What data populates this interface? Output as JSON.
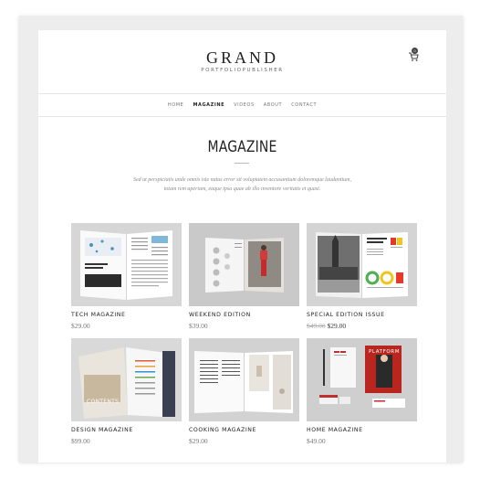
{
  "header": {
    "logo_title": "GRAND",
    "logo_subtitle": "PORTFOLIOPUBLISHER",
    "cart_count": "0"
  },
  "nav": {
    "items": [
      "HOME",
      "MAGAZINE",
      "VIDEOS",
      "ABOUT",
      "CONTACT"
    ],
    "active": "MAGAZINE"
  },
  "hero": {
    "title": "MAGAZINE",
    "intro": "Sed ut perspiciatis unde omnis iste natus error sit voluptatem accusantium doloremque laudantium, totam rem aperiam, eaque ipsa quae ab illo inventore veritatis et quasi."
  },
  "products": [
    {
      "title": "TECH MAGAZINE",
      "price": "$29.00"
    },
    {
      "title": "WEEKEND EDITION",
      "price": "$39.00"
    },
    {
      "title": "SPECIAL EDITION ISSUE",
      "old_price": "$49.00",
      "price": "$29.00"
    },
    {
      "title": "DESIGN MAGAZINE",
      "price": "$99.00"
    },
    {
      "title": "COOKING MAGAZINE",
      "price": "$29.00"
    },
    {
      "title": "HOME MAGAZINE",
      "price": "$49.00"
    }
  ],
  "thumb_texts": {
    "contents": "CONTENTS",
    "platform": "PLATFORM"
  },
  "colors": {
    "frame": "#ededed",
    "thumb_bg": "#dcdcdc",
    "accent_red": "#c0302c"
  }
}
